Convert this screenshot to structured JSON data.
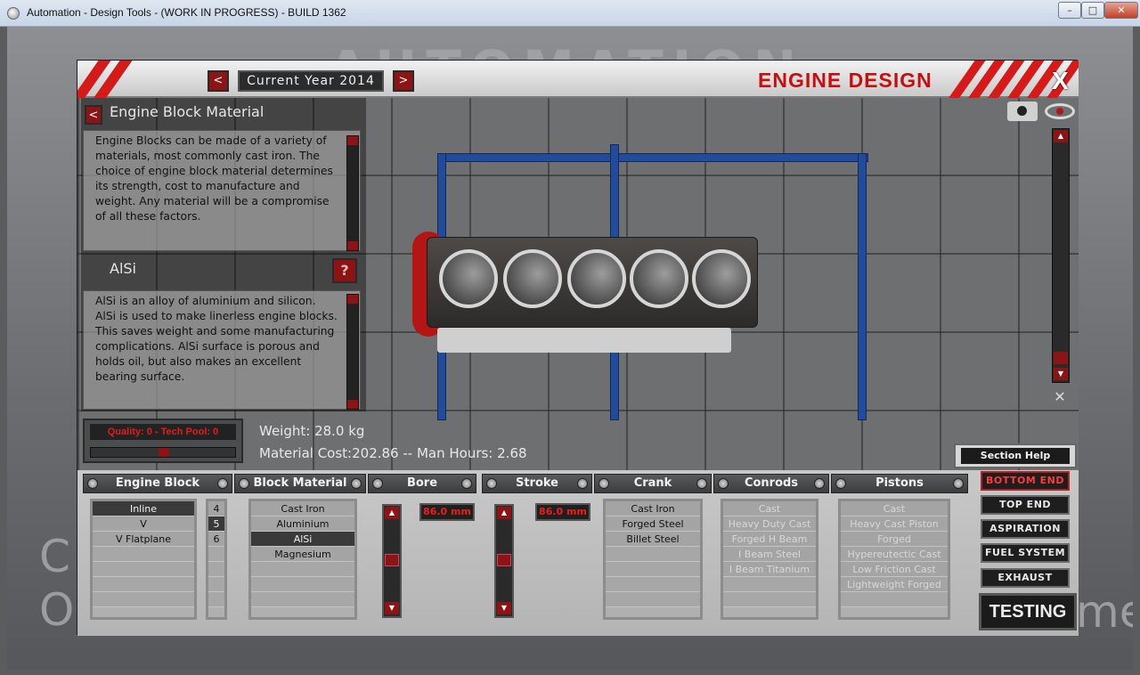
{
  "window": {
    "title": "Automation - Design Tools - (WORK IN PROGRESS) - BUILD 1362"
  },
  "background": {
    "logo": "AUTOMATION",
    "letters": "C\nO",
    "letters_right": "me"
  },
  "header": {
    "year_label": "Current Year 2014",
    "title": "ENGINE DESIGN",
    "close_label": "X",
    "prev_arrow": "<",
    "next_arrow": ">"
  },
  "info": {
    "heading": "Engine Block Material",
    "block_description": "Engine Blocks can be made of a variety of materials, most commonly cast iron. The choice of engine block material determines its strength, cost to manufacture and weight. Any material will be a compromise of all these factors.",
    "selected_material": "AlSi",
    "help_label": "?",
    "material_description": "AlSi is an alloy of aluminium and silicon. AlSi is used to make linerless engine blocks. This saves weight and some manufacturing complications. AlSi surface is porous and holds oil, but also makes an excellent bearing surface."
  },
  "quality": {
    "label": "Quality: 0 - Tech Pool: 0"
  },
  "stats": {
    "weight": "Weight: 28.0 kg",
    "cost": "Material Cost:202.86 -- Man Hours: 2.68"
  },
  "section_help_label": "Section Help",
  "columns": {
    "engine_block": "Engine Block",
    "block_material": "Block Material",
    "bore": "Bore",
    "stroke": "Stroke",
    "crank": "Crank",
    "conrods": "Conrods",
    "pistons": "Pistons"
  },
  "engine_block_list": [
    "Inline",
    "V",
    "V Flatplane"
  ],
  "cylinder_counts": [
    "4",
    "5",
    "6"
  ],
  "material_list": [
    "Cast Iron",
    "Aluminium",
    "AlSi",
    "Magnesium"
  ],
  "bore_value": "86.0 mm",
  "stroke_value": "86.0 mm",
  "crank_list": [
    "Cast Iron",
    "Forged Steel",
    "Billet Steel"
  ],
  "conrod_list": [
    "Cast",
    "Heavy Duty Cast",
    "Forged H Beam",
    "I Beam Steel",
    "I Beam Titanium"
  ],
  "piston_list": [
    "Cast",
    "Heavy Cast Piston",
    "Forged",
    "Hypereutectic Cast",
    "Low Friction Cast",
    "Lightweight Forged"
  ],
  "nav": {
    "bottom_end": "BOTTOM END",
    "top_end": "TOP END",
    "aspiration": "ASPIRATION",
    "fuel_system": "FUEL SYSTEM",
    "exhaust": "EXHAUST",
    "testing": "TESTING"
  },
  "colors": {
    "accent_red": "#c31111",
    "button_red": "#8d1414",
    "frame_blue": "#224c9a"
  }
}
